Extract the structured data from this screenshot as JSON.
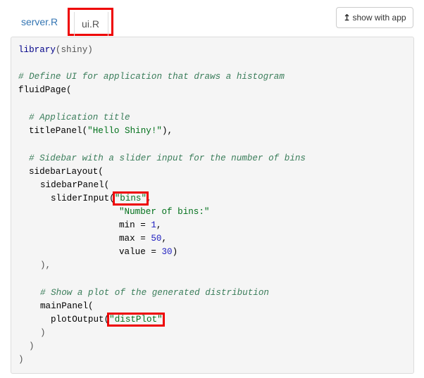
{
  "tabs": [
    {
      "label": "server.R",
      "active": false
    },
    {
      "label": "ui.R",
      "active": true
    }
  ],
  "show_button": {
    "label": "show with app",
    "icon": "arrow-up-icon"
  },
  "code": {
    "line1_fn": "library",
    "line1_arg": "(shiny)",
    "comment1": "# Define UI for application that draws a histogram",
    "fluid_page": "fluidPage(",
    "comment2": "# Application title",
    "title_panel_fn": "titlePanel(",
    "title_panel_arg": "\"Hello Shiny!\"",
    "title_panel_end": "),",
    "comment3": "# Sidebar with a slider input for the number of bins",
    "sidebar_layout": "sidebarLayout(",
    "sidebar_panel": "sidebarPanel(",
    "slider_input_fn": "sliderInput(",
    "slider_input_id": "\"bins\"",
    "slider_label": "\"Number of bins:\"",
    "min_label": "min = ",
    "min_value": "1",
    "max_label": "max = ",
    "max_value": "50",
    "value_label": "value = ",
    "value_value": "30",
    "close_sidebar": "),",
    "comment4": "# Show a plot of the generated distribution",
    "main_panel": "mainPanel(",
    "plot_output_fn": "plotOutput(",
    "plot_output_id": "\"distPlot\"",
    "close1": ")",
    "close2": ")",
    "close3": ")"
  },
  "colors": {
    "highlight": "#ee0000",
    "tab_link": "#3576b3",
    "comment": "#3a7d5a",
    "string": "#00701a",
    "number": "#2020c0"
  }
}
